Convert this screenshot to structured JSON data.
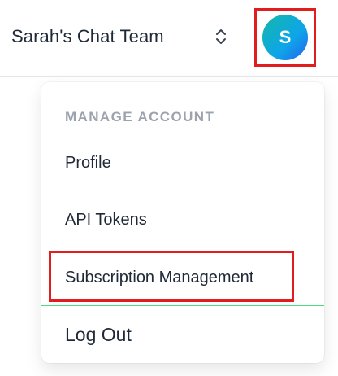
{
  "header": {
    "team_name": "Sarah's Chat Team",
    "switcher_icon": "chevron-up-down-icon",
    "avatar_initial": "S"
  },
  "dropdown": {
    "heading": "MANAGE ACCOUNT",
    "items": [
      {
        "label": "Profile"
      },
      {
        "label": "API Tokens"
      },
      {
        "label": "Subscription Management"
      }
    ],
    "logout_label": "Log Out"
  },
  "colors": {
    "highlight": "#e11d1d",
    "divider": "#4ade80",
    "avatar_gradient_start": "#14b8a6",
    "avatar_gradient_end": "#2563eb"
  }
}
